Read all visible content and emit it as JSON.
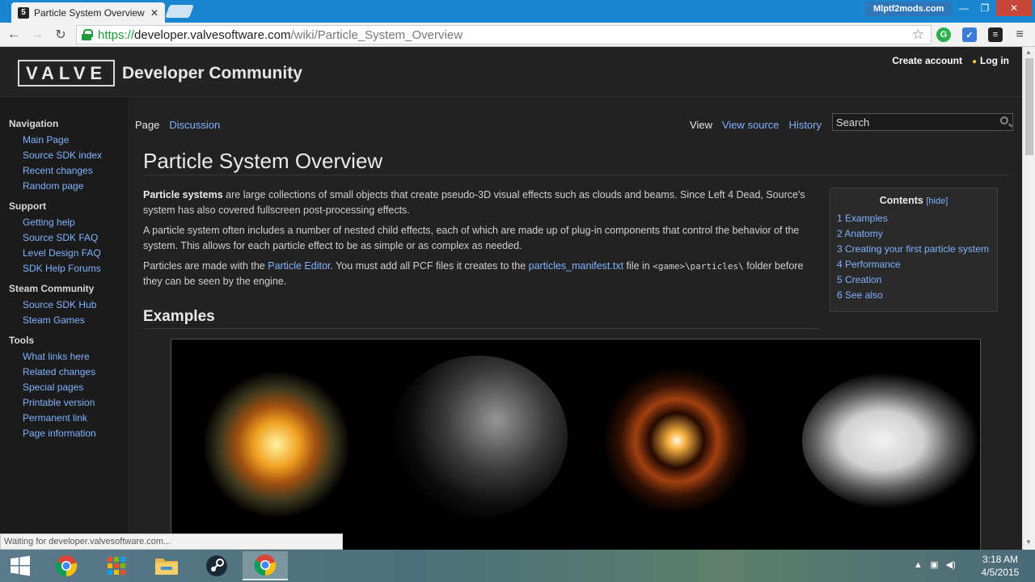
{
  "browser": {
    "tab_title": "Particle System Overview",
    "profile_name": "Mlptf2mods.com",
    "url_https": "https://",
    "url_domain": "developer.valvesoftware.com",
    "url_path": "/wiki/Particle_System_Overview",
    "status_text": "Waiting for developer.valvesoftware.com..."
  },
  "header": {
    "logo_text": "VALVE",
    "site_name": "Developer Community",
    "create_account": "Create account",
    "login": "Log in"
  },
  "sidebar": {
    "sections": [
      {
        "title": "Navigation",
        "items": [
          "Main Page",
          "Source SDK index",
          "Recent changes",
          "Random page"
        ]
      },
      {
        "title": "Support",
        "items": [
          "Getting help",
          "Source SDK FAQ",
          "Level Design FAQ",
          "SDK Help Forums"
        ]
      },
      {
        "title": "Steam Community",
        "items": [
          "Source SDK Hub",
          "Steam Games"
        ]
      },
      {
        "title": "Tools",
        "items": [
          "What links here",
          "Related changes",
          "Special pages",
          "Printable version",
          "Permanent link",
          "Page information"
        ]
      }
    ]
  },
  "page_tabs": {
    "page": "Page",
    "discussion": "Discussion",
    "view": "View",
    "view_source": "View source",
    "history": "History",
    "search_placeholder": "Search"
  },
  "article": {
    "title": "Particle System Overview",
    "p1_bold": "Particle systems",
    "p1_rest": " are large collections of small objects that create pseudo-3D visual effects such as clouds and beams. Since Left 4 Dead, Source's system has also covered fullscreen post-processing effects.",
    "p2": "A particle system often includes a number of nested child effects, each of which are made up of plug-in components that control the behavior of the system. This allows for each particle effect to be as simple or as complex as needed.",
    "p3_a": "Particles are made with the ",
    "p3_link1": "Particle Editor",
    "p3_b": ". You must add all PCF files it creates to the ",
    "p3_link2": "particles_manifest.txt",
    "p3_c": " file in ",
    "p3_code": "<game>\\particles\\",
    "p3_d": " folder before they can be seen by the engine.",
    "section_examples": "Examples"
  },
  "toc": {
    "title": "Contents",
    "hide": "[hide]",
    "items": [
      "1 Examples",
      "2 Anatomy",
      "3 Creating your first particle system",
      "4 Performance",
      "5 Creation",
      "6 See also"
    ]
  },
  "taskbar": {
    "time": "3:18 AM",
    "date": "4/5/2015"
  }
}
